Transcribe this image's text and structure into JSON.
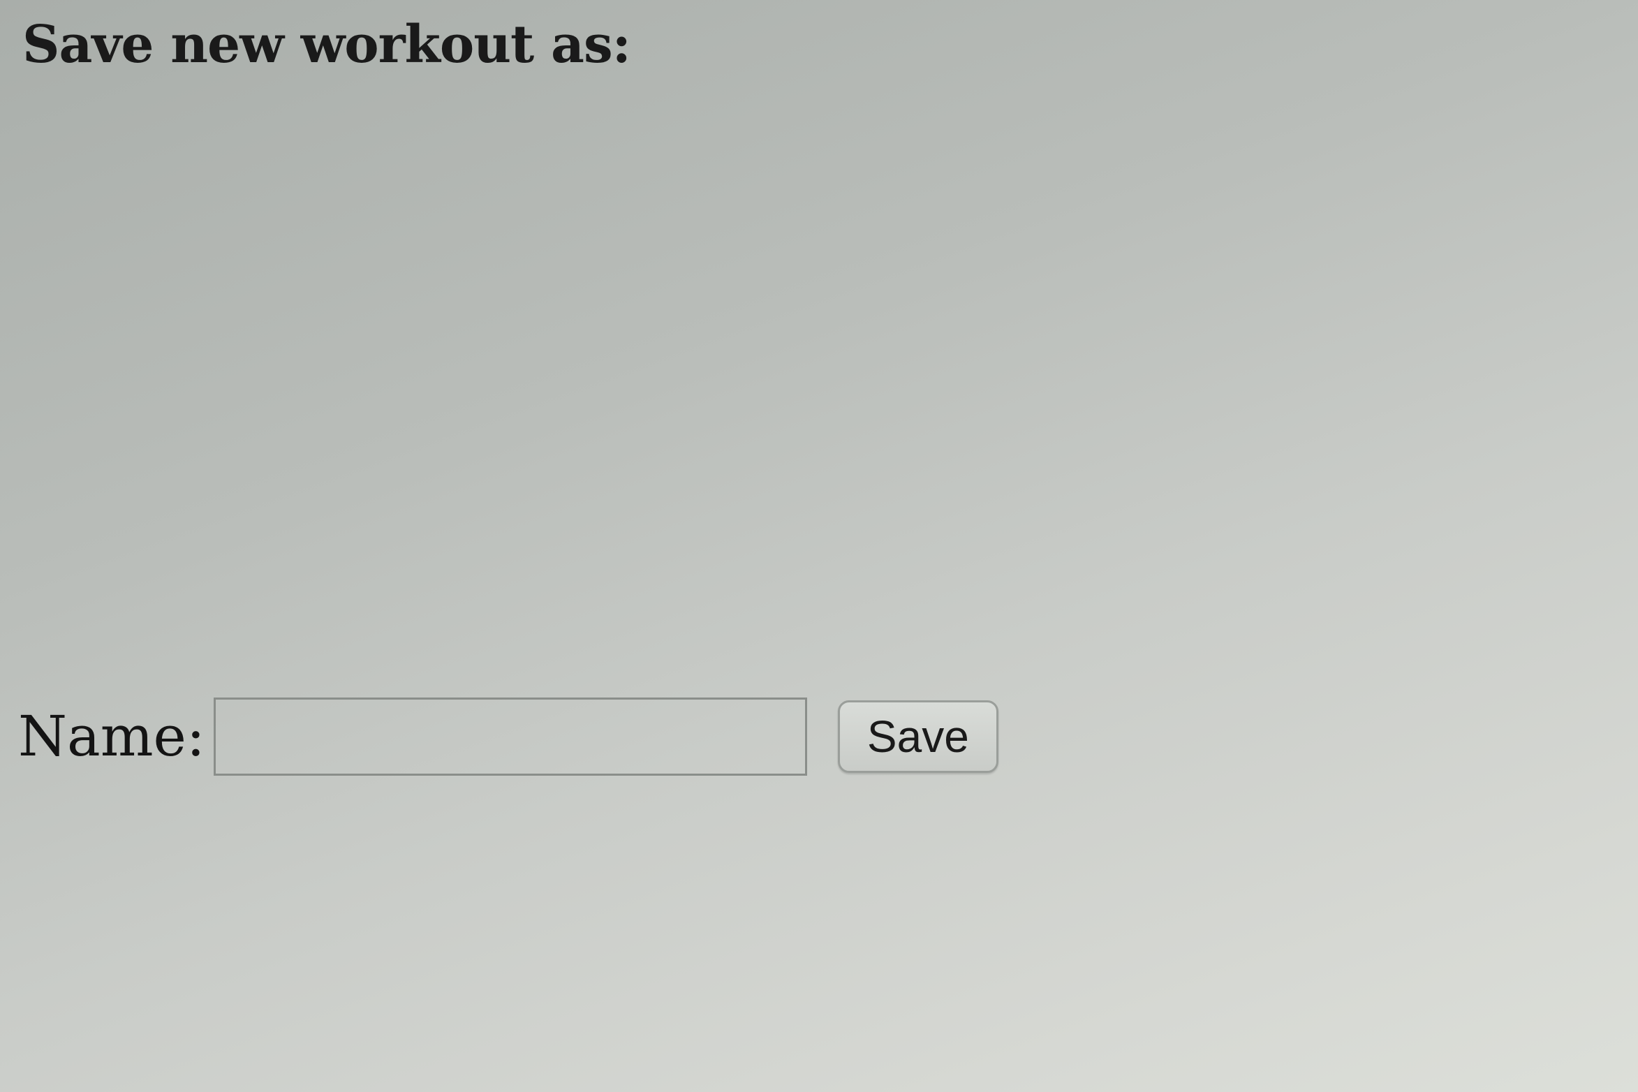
{
  "page": {
    "title": "Save new workout as:"
  },
  "form": {
    "name_label": "Name:",
    "name_value": "",
    "name_placeholder": "",
    "save_label": "Save"
  }
}
